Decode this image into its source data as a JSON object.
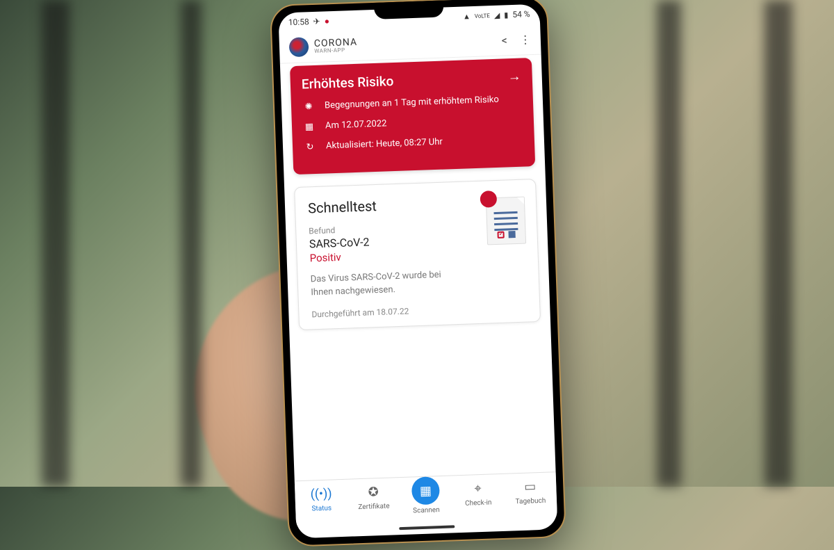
{
  "status_bar": {
    "time": "10:58",
    "battery": "54 %"
  },
  "app_header": {
    "title": "CORONA",
    "subtitle": "WARN-APP"
  },
  "risk_card": {
    "title": "Erhöhtes Risiko",
    "encounters": "Begegnungen an 1 Tag mit erhöhtem Risiko",
    "date": "Am 12.07.2022",
    "updated": "Aktualisiert: Heute, 08:27 Uhr"
  },
  "test_card": {
    "title": "Schnelltest",
    "label": "Befund",
    "name": "SARS-CoV-2",
    "result": "Positiv",
    "description": "Das Virus SARS-CoV-2 wurde bei Ihnen nachgewiesen.",
    "performed": "Durchgeführt am 18.07.22"
  },
  "nav": {
    "status": "Status",
    "certificates": "Zertifikate",
    "scan": "Scannen",
    "checkin": "Check-in",
    "diary": "Tagebuch"
  }
}
